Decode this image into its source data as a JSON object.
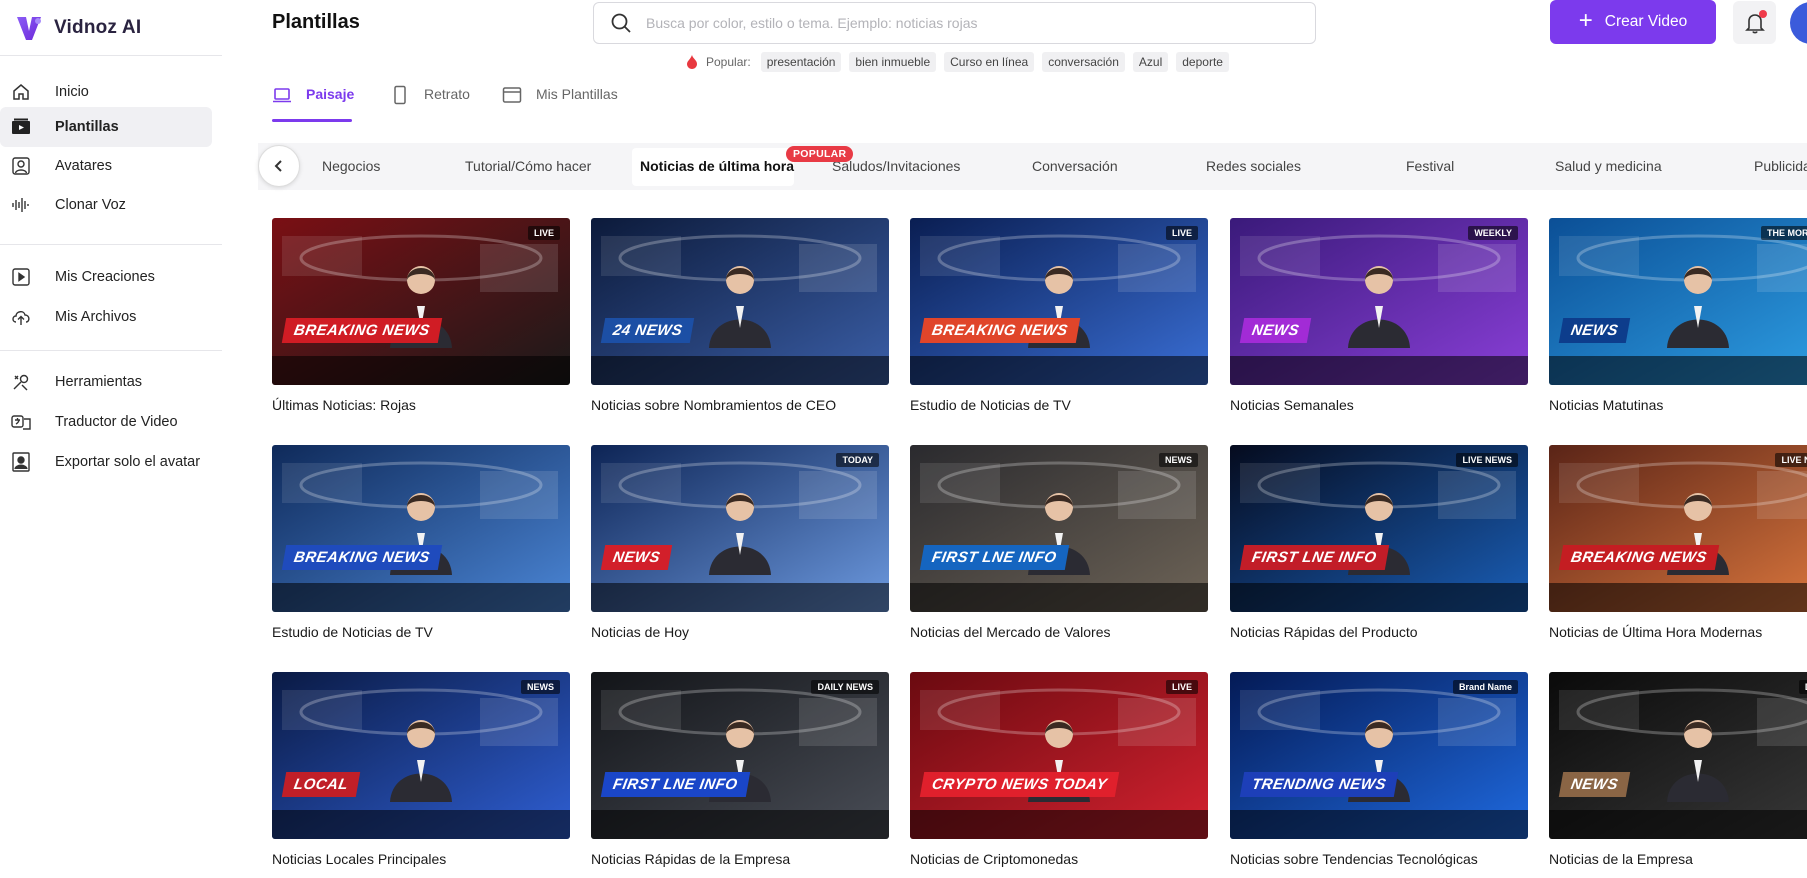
{
  "app": {
    "name": "Vidnoz AI"
  },
  "sidebar": {
    "items": [
      {
        "label": "Inicio",
        "icon": "home-icon"
      },
      {
        "label": "Plantillas",
        "icon": "templates-icon",
        "active": true
      },
      {
        "label": "Avatares",
        "icon": "avatar-icon"
      },
      {
        "label": "Clonar Voz",
        "icon": "voice-wave-icon"
      },
      {
        "label": "Mis Creaciones",
        "icon": "video-play-icon"
      },
      {
        "label": "Mis Archivos",
        "icon": "upload-cloud-icon"
      },
      {
        "label": "Herramientas",
        "icon": "tools-icon"
      },
      {
        "label": "Traductor de Video",
        "icon": "translate-icon"
      },
      {
        "label": "Exportar solo el avatar",
        "icon": "export-avatar-icon"
      }
    ]
  },
  "header": {
    "title": "Plantillas",
    "search_placeholder": "Busca por color, estilo o tema. Ejemplo: noticias rojas",
    "popular_label": "Popular:",
    "popular_tags": [
      "presentación",
      "bien inmueble",
      "Curso en línea",
      "conversación",
      "Azul",
      "deporte"
    ],
    "create_label": "Crear Video"
  },
  "orientation_tabs": [
    {
      "label": "Paisaje",
      "active": true
    },
    {
      "label": "Retrato"
    },
    {
      "label": "Mis Plantillas"
    }
  ],
  "categories": {
    "items": [
      "Negocios",
      "Tutorial/Cómo hacer",
      "Noticias de última hora",
      "Saludos/Invitaciones",
      "Conversación",
      "Redes sociales",
      "Festival",
      "Salud y medicina",
      "Publicida"
    ],
    "active": "Noticias de última hora",
    "badge": "POPULAR"
  },
  "colors": {
    "accent": "#7c3aed",
    "badge_red": "#e83a45"
  },
  "templates": [
    {
      "title": "Últimas Noticias: Rojas",
      "bg": "#7a0f14",
      "bg2": "#1a1a1a",
      "banner_text": "BREAKING NEWS",
      "banner_color": "#d01c24",
      "tag": "LIVE"
    },
    {
      "title": "Noticias sobre Nombramientos de CEO",
      "bg": "#0c1a3a",
      "bg2": "#3b5fa8",
      "banner_text": "24 NEWS",
      "banner_color": "#1c4fa5",
      "tag": ""
    },
    {
      "title": "Estudio de Noticias de TV",
      "bg": "#0a1e52",
      "bg2": "#3a6fd6",
      "banner_text": "BREAKING NEWS",
      "banner_color": "#e0452a",
      "tag": "LIVE"
    },
    {
      "title": "Noticias Semanales",
      "bg": "#3a1a7a",
      "bg2": "#8a3fd8",
      "banner_text": "NEWS",
      "banner_color": "#a22bd6",
      "tag": "WEEKLY"
    },
    {
      "title": "Noticias Matutinas",
      "bg": "#0b4f96",
      "bg2": "#2fa1e6",
      "banner_text": "NEWS",
      "banner_color": "#0d3d8c",
      "tag": "THE MORNING"
    },
    {
      "title": "Estudio de Noticias de TV",
      "bg": "#0f2a5a",
      "bg2": "#4b86d6",
      "banner_text": "BREAKING NEWS",
      "banner_color": "#1f4bbd",
      "tag": ""
    },
    {
      "title": "Noticias de Hoy",
      "bg": "#0d2455",
      "bg2": "#6d9ae0",
      "banner_text": "NEWS",
      "banner_color": "#d21f2a",
      "tag": "TODAY"
    },
    {
      "title": "Noticias del Mercado de Valores",
      "bg": "#2a2a2e",
      "bg2": "#6e6457",
      "banner_text": "FIRST LNE INFO",
      "banner_color": "#1565c0",
      "tag": "NEWS"
    },
    {
      "title": "Noticias Rápidas del Producto",
      "bg": "#050b1e",
      "bg2": "#1a5fb8",
      "banner_text": "FIRST LNE INFO",
      "banner_color": "#c21d28",
      "tag": "LIVE NEWS"
    },
    {
      "title": "Noticias de Última Hora Modernas",
      "bg": "#5a2417",
      "bg2": "#e07a3f",
      "banner_text": "BREAKING NEWS",
      "banner_color": "#c41d22",
      "tag": "LIVE NEWS"
    },
    {
      "title": "Noticias Locales Principales",
      "bg": "#0a1a44",
      "bg2": "#2f5fd4",
      "banner_text": "LOCAL",
      "banner_color": "#c01f28",
      "tag": "NEWS"
    },
    {
      "title": "Noticias Rápidas de la Empresa",
      "bg": "#121418",
      "bg2": "#4a4e57",
      "banner_text": "FIRST LNE INFO",
      "banner_color": "#1a46c8",
      "tag": "DAILY NEWS"
    },
    {
      "title": "Noticias de Criptomonedas",
      "bg": "#6a0a10",
      "bg2": "#d42230",
      "banner_text": "CRYPTO NEWS TODAY",
      "banner_color": "#e0202c",
      "tag": "LIVE"
    },
    {
      "title": "Noticias sobre Tendencias Tecnológicas",
      "bg": "#041a55",
      "bg2": "#1f6ae0",
      "banner_text": "TRENDING NEWS",
      "banner_color": "#1d3fb8",
      "tag": "Brand Name"
    },
    {
      "title": "Noticias de la Empresa",
      "bg": "#0a0a0a",
      "bg2": "#3a3a3a",
      "banner_text": "NEWS",
      "banner_color": "#8a6545",
      "tag": "DAILY"
    }
  ]
}
